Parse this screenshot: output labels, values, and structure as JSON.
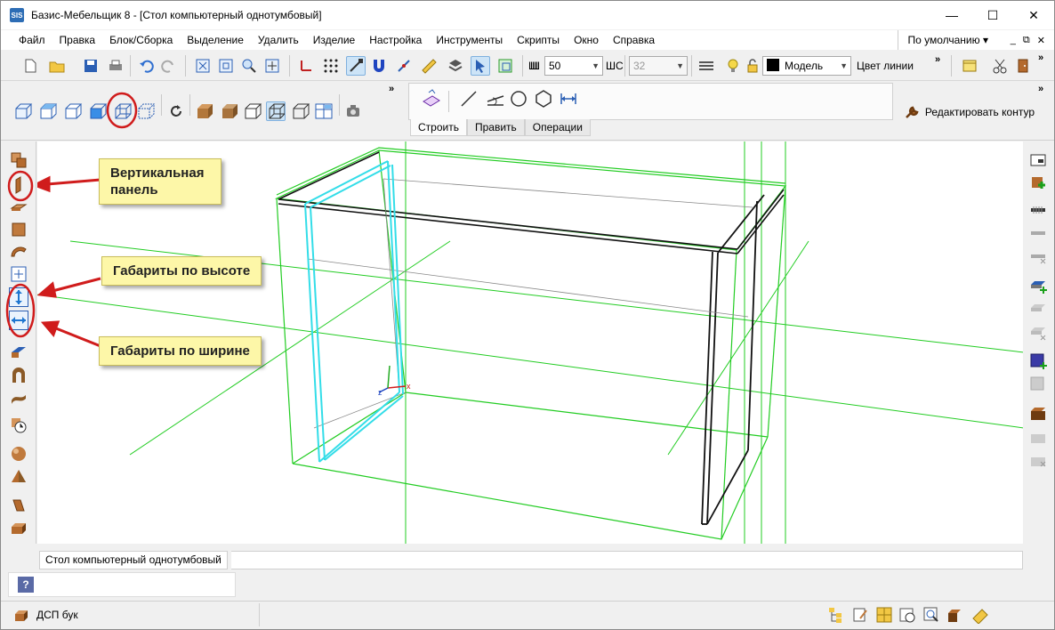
{
  "window": {
    "app_icon_text": "SIS",
    "title": "Базис-Мебельщик 8 - [Стол компьютерный однотумбовый]",
    "minimize": "—",
    "maximize": "☐",
    "close": "✕"
  },
  "menu": {
    "items": [
      "Файл",
      "Правка",
      "Блок/Сборка",
      "Выделение",
      "Удалить",
      "Изделие",
      "Настройка",
      "Инструменты",
      "Скрипты",
      "Окно",
      "Справка"
    ],
    "preset": "По умолчанию ▾",
    "mdi_min": "_",
    "mdi_restore": "⧉",
    "mdi_close": "✕"
  },
  "toolbar1": {
    "width_label": "Ш",
    "width_value": "50",
    "step_label": "ШС",
    "step_value": "32",
    "layer_value": "Модель",
    "line_color_label": "Цвет линии"
  },
  "build_panel": {
    "tabs": [
      "Строить",
      "Править",
      "Операции"
    ]
  },
  "edit_contour": "Редактировать контур",
  "callouts": {
    "vertical_panel": "Вертикальная панель",
    "height_dims": "Габариты по высоте",
    "width_dims": "Габариты по ширине"
  },
  "doc_tab": "Стол компьютерный однотумбовый",
  "status": {
    "material": "ДСП бук",
    "help": "?"
  },
  "colors": {
    "accent_red": "#d01c1c",
    "frame_green": "#22cc22",
    "panel_cyan": "#33dde8",
    "callout_yellow": "#fdf7a8"
  }
}
